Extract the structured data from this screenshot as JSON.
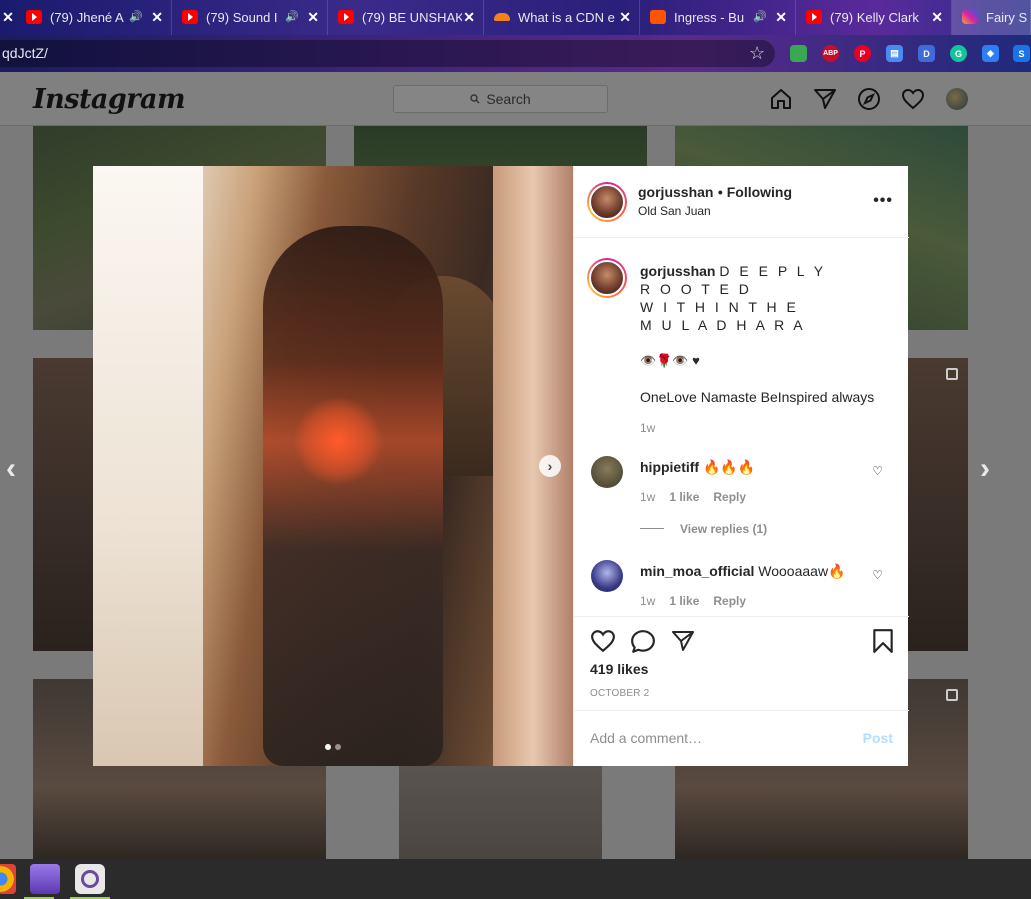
{
  "browser": {
    "tabs": [
      {
        "title": "(79) Jhené A",
        "icon": "youtube-icon",
        "muted": true
      },
      {
        "title": "(79) Sound I",
        "icon": "youtube-icon",
        "muted": true
      },
      {
        "title": "(79) BE UNSHAK",
        "icon": "youtube-icon",
        "muted": false
      },
      {
        "title": "What is a CDN e",
        "icon": "cloudflare-icon",
        "muted": false
      },
      {
        "title": "Ingress - Bu",
        "icon": "soundcloud-icon",
        "muted": true
      },
      {
        "title": "(79) Kelly Clark",
        "icon": "youtube-icon",
        "muted": false
      },
      {
        "title": "Fairy S",
        "icon": "instagram-icon",
        "muted": false
      }
    ],
    "close_glyph": "✕",
    "url": "qdJctZ/",
    "extensions": [
      {
        "name": "ext-icon",
        "label": "",
        "color": "#3aa757"
      },
      {
        "name": "adblock-icon",
        "label": "ABP",
        "color": "#c70d2c"
      },
      {
        "name": "pinterest-icon",
        "label": "P",
        "color": "#e60023"
      },
      {
        "name": "reader-icon",
        "label": "▤",
        "color": "#4a8af4"
      },
      {
        "name": "d-icon",
        "label": "D",
        "color": "#3f6ad8"
      },
      {
        "name": "grammarly-icon",
        "label": "G",
        "color": "#15c39a"
      },
      {
        "name": "bookmark-ext-icon",
        "label": "◆",
        "color": "#2d7df6"
      },
      {
        "name": "s-ext-icon",
        "label": "S",
        "color": "#1a73e8"
      }
    ]
  },
  "instagram": {
    "logo": "Instagram",
    "search_placeholder": "Search",
    "nav": [
      "home-icon",
      "direct-icon",
      "explore-icon",
      "activity-heart-icon",
      "profile-avatar"
    ]
  },
  "post": {
    "username": "gorjusshan",
    "following_label": "• Following",
    "location": "Old San Juan",
    "caption_lines": [
      "D E E P L Y",
      "R O O T E D",
      "W I T H I N T H E",
      "M U L A D H A R A"
    ],
    "emoji_line": "👁️🌹👁️ ♥",
    "caption_tail": "OneLove Namaste BeInspired always",
    "caption_time": "1w",
    "comments": [
      {
        "user": "hippietiff",
        "text": "🔥🔥🔥",
        "time": "1w",
        "likes": "1 like",
        "reply": "Reply",
        "view_replies": "View replies (1)"
      },
      {
        "user": "min_moa_official",
        "text": "Woooaaaw🔥",
        "time": "1w",
        "likes": "1 like",
        "reply": "Reply"
      }
    ],
    "likes": "419 likes",
    "date": "OCTOBER 2",
    "add_comment_placeholder": "Add a comment…",
    "post_button": "Post",
    "next_arrow": "›",
    "carousel_slides": 2,
    "carousel_active": 1
  },
  "page_nav": {
    "prev": "‹",
    "next": "›"
  },
  "taskbar": {
    "apps": [
      {
        "name": "chrome-icon",
        "color": "#f4b400"
      },
      {
        "name": "files-icon",
        "color": "#7a5ac8"
      },
      {
        "name": "camera-app-icon",
        "color": "#e0e0e0"
      }
    ]
  }
}
